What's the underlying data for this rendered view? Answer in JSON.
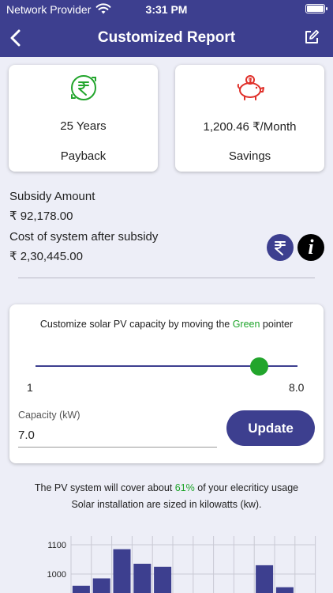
{
  "status_bar": {
    "carrier": "Network Provider",
    "time": "3:31 PM"
  },
  "nav": {
    "title": "Customized Report"
  },
  "summary": {
    "payback": {
      "value": "25 Years",
      "label": "Payback",
      "icon": "rupee-cycle-icon"
    },
    "savings": {
      "value": "1,200.46 ₹/Month",
      "label": "Savings",
      "icon": "piggy-bank-icon"
    }
  },
  "subsidy": {
    "amount_label": "Subsidy Amount",
    "amount_value": "₹ 92,178.00",
    "cost_label": "Cost of system after subsidy",
    "cost_value": "₹ 2,30,445.00"
  },
  "capacity": {
    "instruction_prefix": "Customize solar PV capacity by moving the ",
    "instruction_highlight": "Green",
    "instruction_suffix": " pointer",
    "slider_min": "1",
    "slider_max": "8.0",
    "slider_value": 7.0,
    "field_label": "Capacity (kW)",
    "field_value": "7.0",
    "update_label": "Update"
  },
  "coverage": {
    "line1_prefix": "The PV system will cover about ",
    "line1_pct": "61%",
    "line1_suffix": " of your elecriticy usage",
    "line2": "Solar installation are sized in kilowatts (kw)."
  },
  "colors": {
    "primary": "#3d3f8f",
    "accent_green": "#22a52c",
    "background": "#edeef7"
  },
  "chart_data": {
    "type": "bar",
    "ylim": [
      950,
      1120
    ],
    "y_ticks": [
      1000,
      1100
    ],
    "tick_labels": [
      "1000",
      "1100"
    ],
    "bars": [
      {
        "x_index": 1,
        "value": 960
      },
      {
        "x_index": 2,
        "value": 985
      },
      {
        "x_index": 3,
        "value": 1085
      },
      {
        "x_index": 4,
        "value": 1035
      },
      {
        "x_index": 5,
        "value": 1025
      },
      {
        "x_index": 10,
        "value": 1030
      },
      {
        "x_index": 11,
        "value": 955
      }
    ],
    "grid": true
  }
}
